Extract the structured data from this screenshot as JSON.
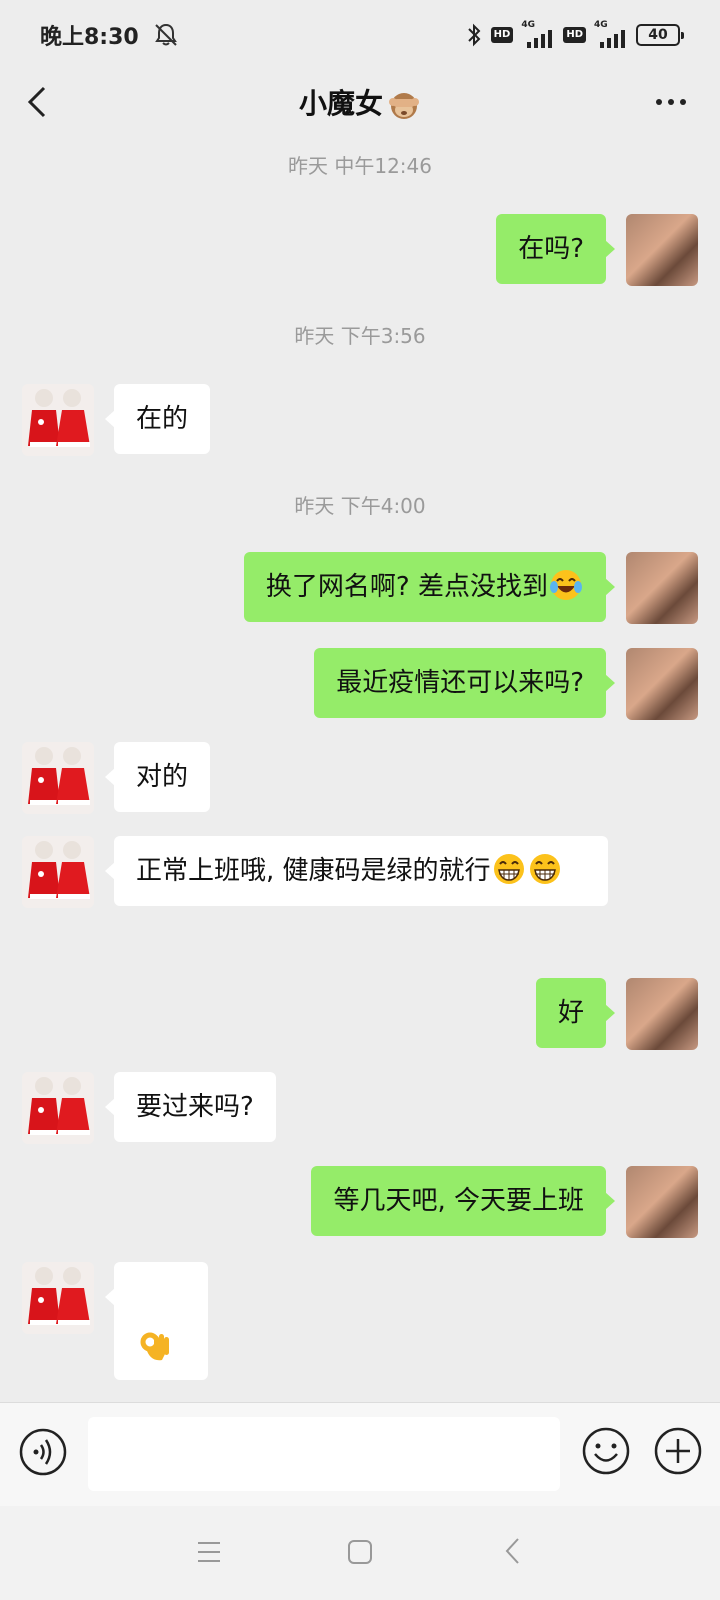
{
  "status_bar": {
    "time": "晚上8:30",
    "hd1": "HD",
    "net1": "4G",
    "hd2": "HD",
    "net2": "4G",
    "battery": "40"
  },
  "header": {
    "title": "小魔女",
    "title_emoji": "see-no-evil-monkey-icon"
  },
  "messages": [
    {
      "type": "time",
      "text": "昨天 中午12:46"
    },
    {
      "type": "msg",
      "side": "me",
      "text": "在吗?"
    },
    {
      "type": "time",
      "text": "昨天 下午3:56"
    },
    {
      "type": "msg",
      "side": "other",
      "text": "在的"
    },
    {
      "type": "time",
      "text": "昨天 下午4:00"
    },
    {
      "type": "msg",
      "side": "me",
      "text": "换了网名啊? 差点没找到",
      "emoji": "laughing-crying-face-icon"
    },
    {
      "type": "msg",
      "side": "me",
      "text": "最近疫情还可以来吗?"
    },
    {
      "type": "msg",
      "side": "other",
      "text": "对的"
    },
    {
      "type": "msg",
      "side": "other",
      "text": "正常上班哦, 健康码是绿的就行",
      "emoji": "grinning-face-icon"
    },
    {
      "type": "msg",
      "side": "me",
      "text": "好"
    },
    {
      "type": "msg",
      "side": "other",
      "text": "要过来吗?"
    },
    {
      "type": "msg",
      "side": "me",
      "text": "等几天吧, 今天要上班"
    },
    {
      "type": "msg",
      "side": "other",
      "text": "",
      "emoji": "ok-hand-icon"
    }
  ],
  "input": {
    "value": "",
    "placeholder": ""
  },
  "colors": {
    "background": "#ededed",
    "my_bubble": "#95ec69",
    "other_bubble": "#ffffff",
    "timestamp": "#9a9a9a"
  }
}
